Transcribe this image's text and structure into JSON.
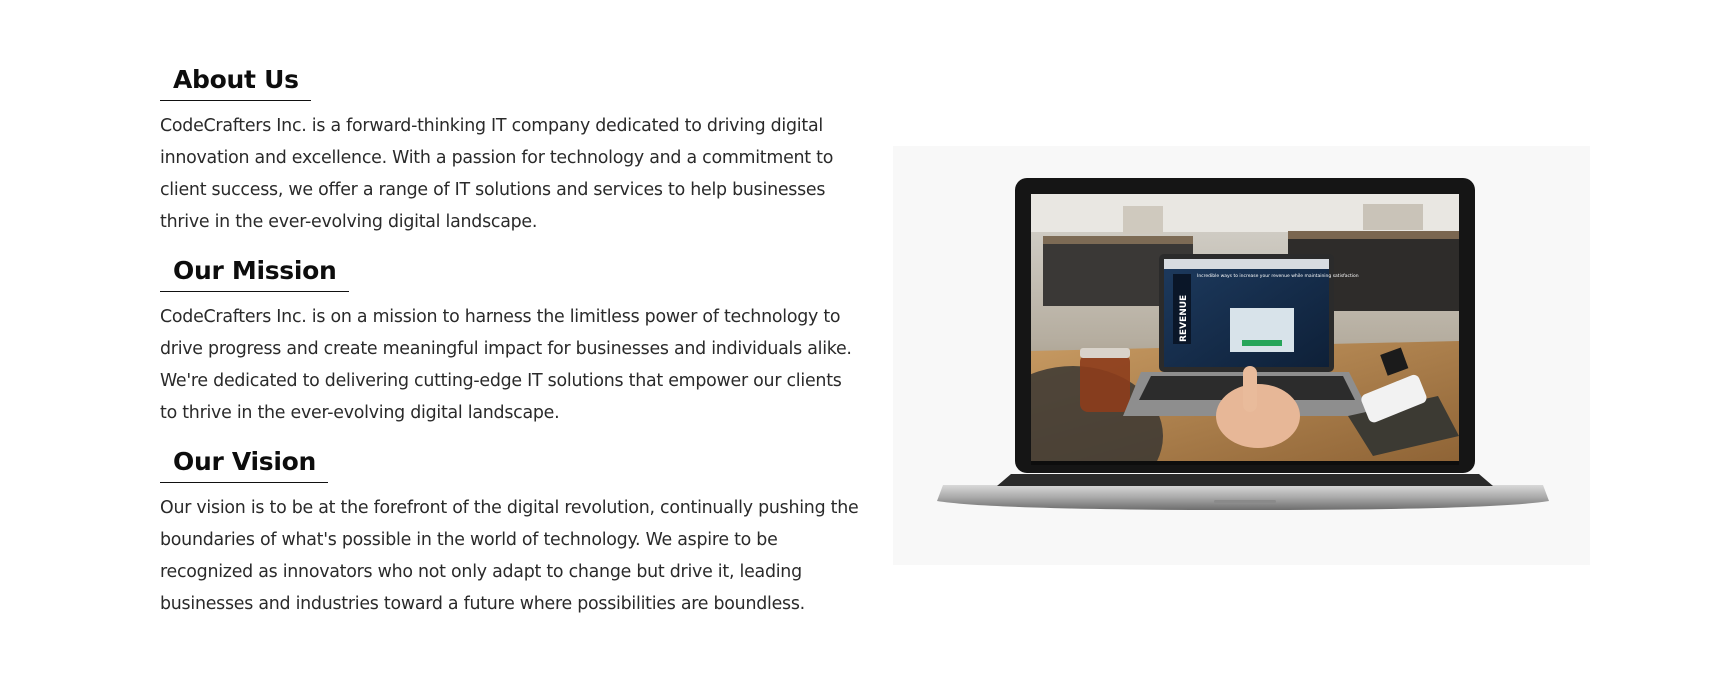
{
  "about": {
    "heading": "About Us",
    "text": "CodeCrafters Inc. is a forward-thinking IT company dedicated to driving digital innovation and excellence. With a passion for technology and a commitment to client success, we offer a range of IT solutions and services to help businesses thrive in the ever-evolving digital landscape."
  },
  "mission": {
    "heading": "Our Mission",
    "text": "CodeCrafters Inc. is on a mission to harness the limitless power of technology to drive progress and create meaningful impact for businesses and individuals alike. We're dedicated to delivering cutting-edge IT solutions that empower our clients to thrive in the ever-evolving digital landscape."
  },
  "vision": {
    "heading": "Our Vision",
    "text": "Our vision is to be at the forefront of the digital revolution, continually pushing the boundaries of what's possible in the world of technology. We aspire to be recognized as innovators who not only adapt to change but drive it, leading businesses and industries toward a future where possibilities are boundless."
  },
  "image": {
    "screen_text": "Incredible ways to increase your revenue while maintaining satisfaction",
    "banner_text": "REVENUE"
  }
}
